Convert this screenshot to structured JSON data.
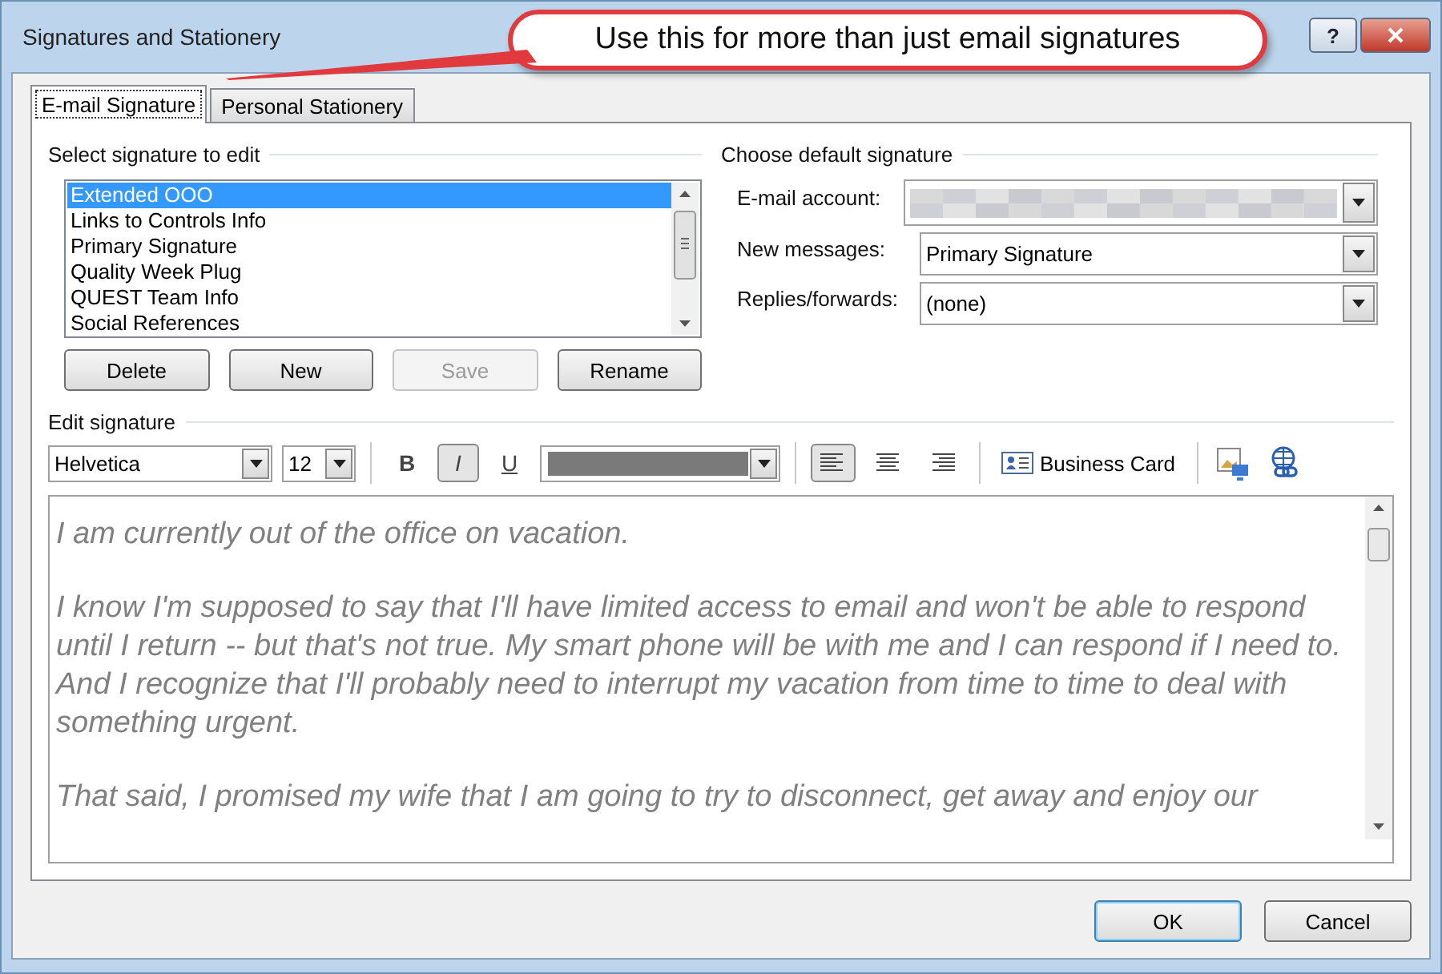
{
  "window": {
    "title": "Signatures and Stationery",
    "help": "?"
  },
  "callout": {
    "text": "Use this for more than just email signatures"
  },
  "tabs": [
    {
      "label": "E-mail Signature",
      "selected": true
    },
    {
      "label": "Personal Stationery",
      "selected": false
    }
  ],
  "signature_list": {
    "label": "Select signature to edit",
    "items": [
      {
        "label": "Extended OOO",
        "selected": true
      },
      {
        "label": "Links to Controls Info",
        "selected": false
      },
      {
        "label": "Primary Signature",
        "selected": false
      },
      {
        "label": "Quality Week Plug",
        "selected": false
      },
      {
        "label": "QUEST Team Info",
        "selected": false
      },
      {
        "label": "Social References",
        "selected": false
      }
    ]
  },
  "list_buttons": [
    {
      "label": "Delete",
      "disabled": false
    },
    {
      "label": "New",
      "disabled": false
    },
    {
      "label": "Save",
      "disabled": true
    },
    {
      "label": "Rename",
      "disabled": false
    }
  ],
  "default_signature": {
    "label": "Choose default signature",
    "fields": [
      {
        "label": "E-mail account:",
        "kind": "blurred"
      },
      {
        "label": "New messages:",
        "kind": "text",
        "value": "Primary Signature"
      },
      {
        "label": "Replies/forwards:",
        "kind": "text",
        "value": "(none)"
      }
    ]
  },
  "editor": {
    "label": "Edit signature",
    "font": "Helvetica",
    "size": "12",
    "format_buttons": [
      {
        "label": "B",
        "kind": "bold",
        "pressed": false
      },
      {
        "label": "I",
        "kind": "italic",
        "pressed": true
      },
      {
        "label": "U",
        "kind": "underline",
        "pressed": false
      }
    ],
    "alignments": [
      {
        "kind": "left",
        "selected": true
      },
      {
        "kind": "center",
        "selected": false
      },
      {
        "kind": "right",
        "selected": false
      }
    ],
    "business_card": "Business Card",
    "paragraphs": [
      "I am currently out of the office on vacation.",
      "I know I'm supposed to say that I'll have limited access to email and won't be able to respond until I return -- but that's not true. My smart phone will be with me and I can respond if I need to. And I recognize that I'll probably need to interrupt my vacation from time to time to deal with something urgent.",
      "That said, I promised my wife that I am going to try to disconnect, get away and enjoy our"
    ]
  },
  "footer_buttons": [
    {
      "label": "OK",
      "default": true
    },
    {
      "label": "Cancel",
      "default": false
    }
  ]
}
